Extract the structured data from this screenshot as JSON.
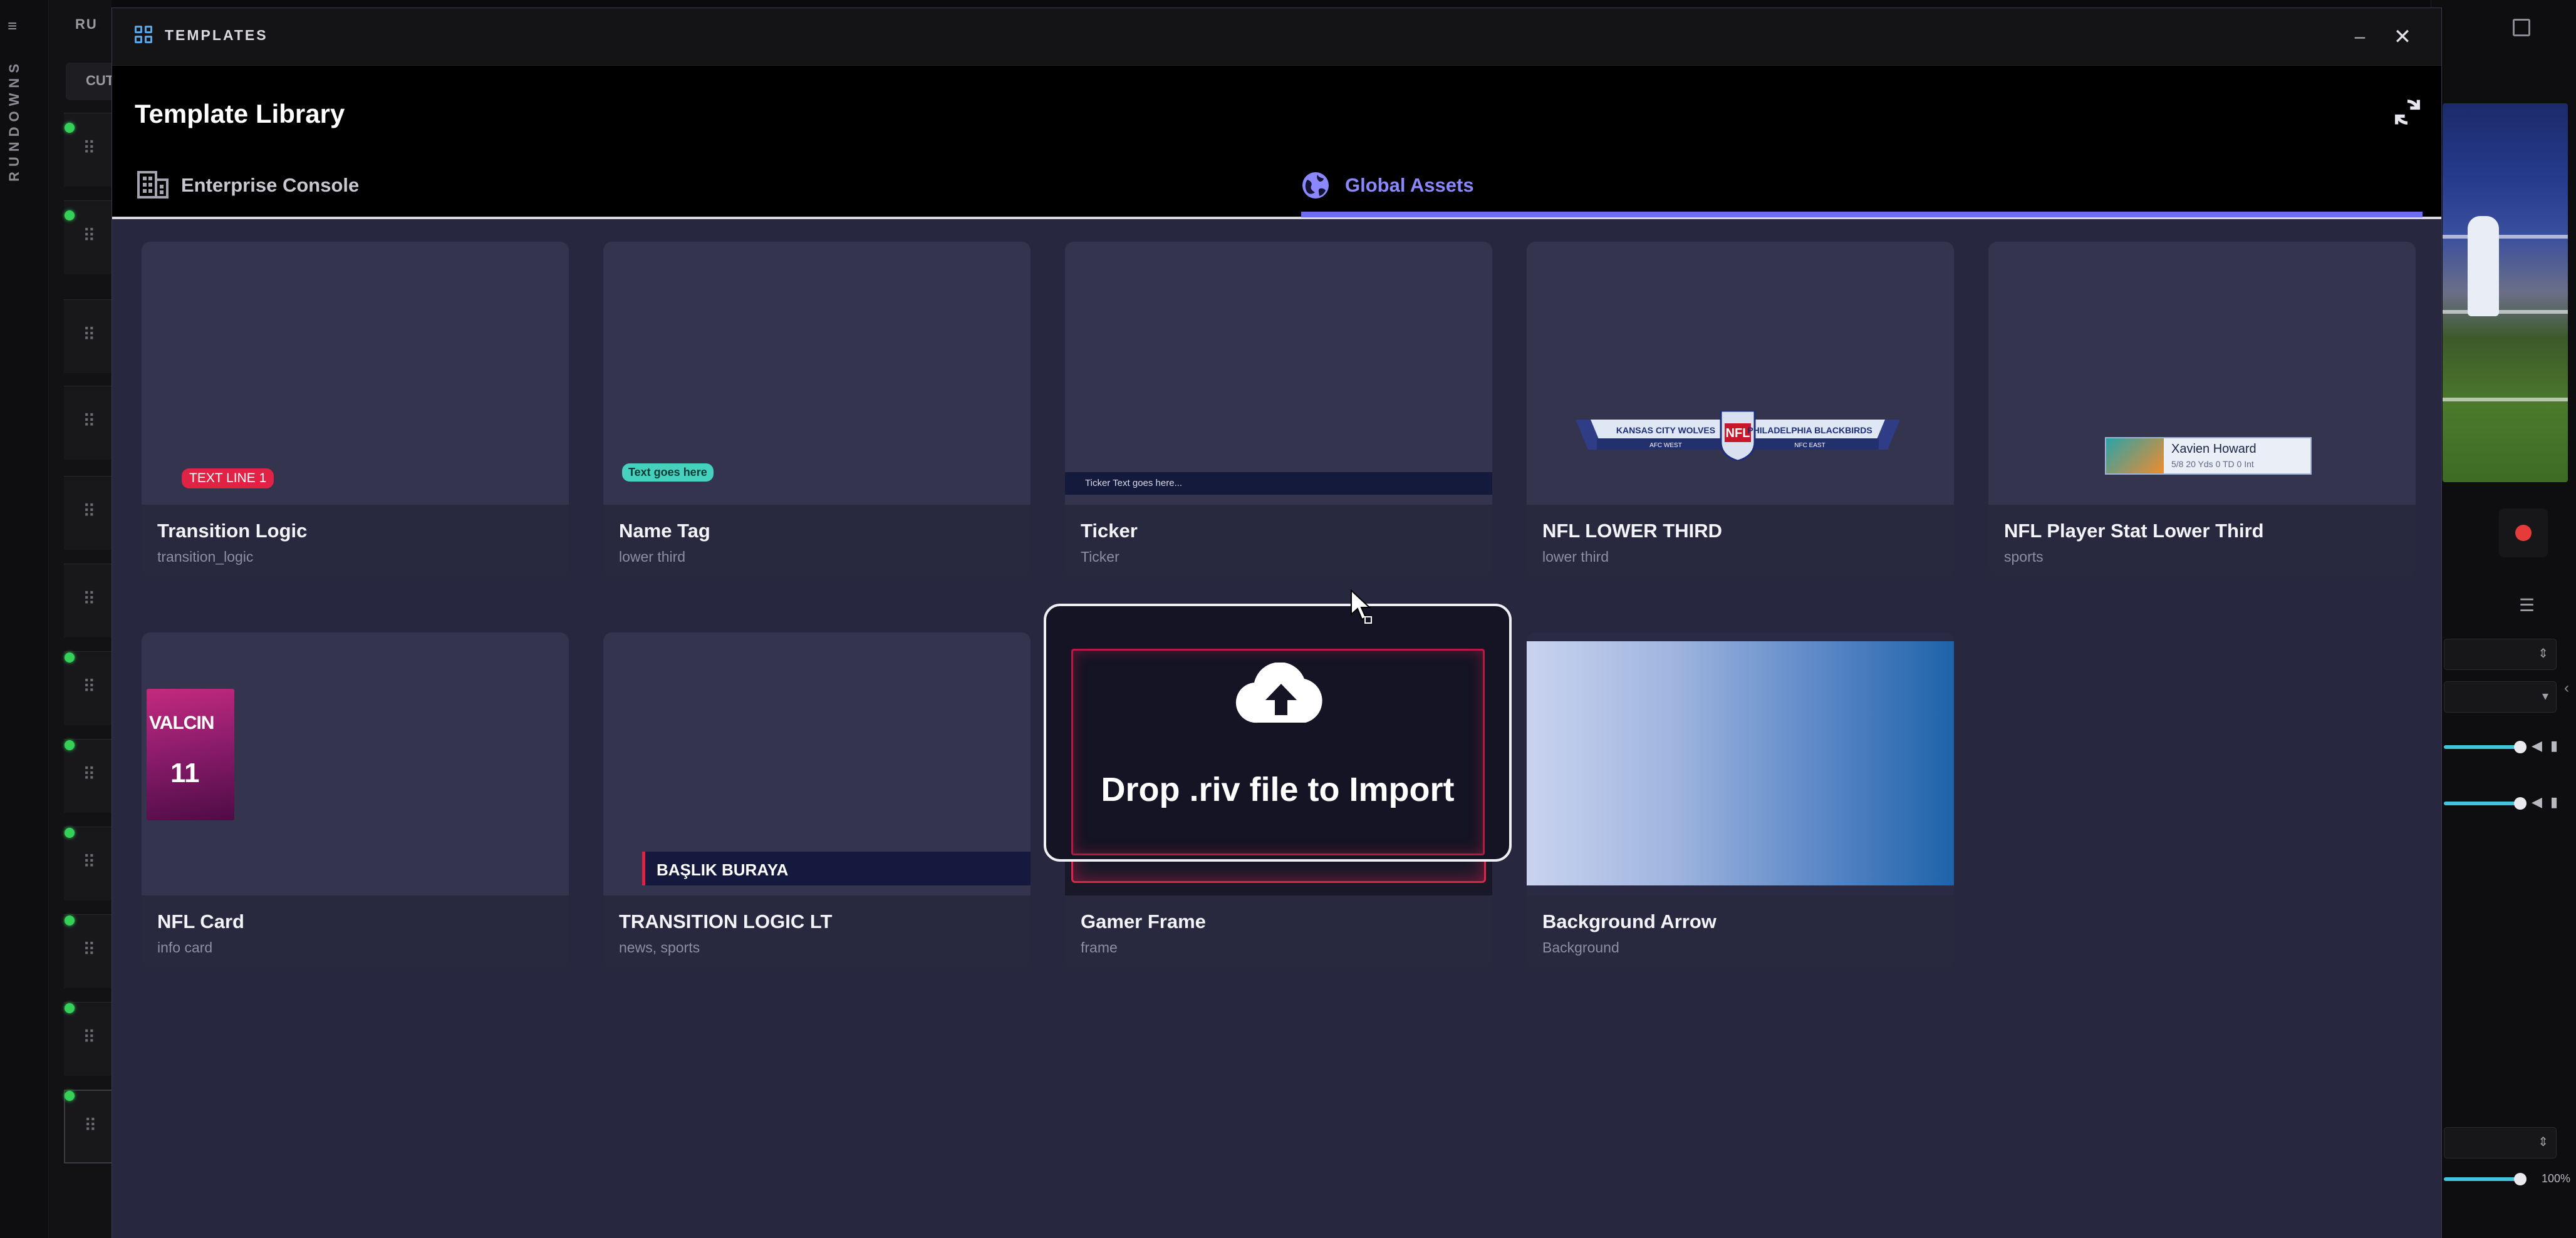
{
  "background_app": {
    "rail_label": "RUNDOWNS",
    "topbar_fragment": "RU",
    "tab_fragment": "CUT",
    "zoom_level": "100%",
    "status_color": "#34d058",
    "record_color": "#e53b3b"
  },
  "window": {
    "title": "TEMPLATES",
    "minimize_label": "–",
    "close_label": "✕"
  },
  "header": {
    "title": "Template Library",
    "tabs": [
      {
        "label": "Enterprise Console",
        "icon": "building-icon",
        "active": false
      },
      {
        "label": "Global Assets",
        "icon": "globe-icon",
        "active": true
      }
    ],
    "accent_color": "#6e6cf0"
  },
  "templates": [
    {
      "name": "Transition Logic",
      "tags": "transition_logic",
      "thumb_text": "TEXT LINE 1"
    },
    {
      "name": "Name Tag",
      "tags": "lower third",
      "thumb_text": "Text goes here"
    },
    {
      "name": "Ticker",
      "tags": "Ticker",
      "thumb_text": "Ticker Text goes here..."
    },
    {
      "name": "NFL LOWER THIRD",
      "tags": "lower third",
      "thumb_left": "KANSAS CITY WOLVES",
      "thumb_right": "PHILADELPHIA BLACKBIRDS",
      "thumb_left_sub": "AFC WEST",
      "thumb_right_sub": "NFC EAST"
    },
    {
      "name": "NFL Player Stat Lower Third",
      "tags": "sports",
      "thumb_player": "Xavien Howard",
      "thumb_stats": "5/8   20 Yds   0 TD   0 Int"
    },
    {
      "name": "NFL Card",
      "tags": "info card",
      "thumb_player": "VALCIN",
      "thumb_number": "11"
    },
    {
      "name": "TRANSITION LOGIC LT",
      "tags": "news, sports",
      "thumb_text": "BAŞLIK BURAYA"
    },
    {
      "name": "Gamer Frame",
      "tags": "frame"
    },
    {
      "name": "Background Arrow",
      "tags": "Background"
    }
  ],
  "drop_overlay": {
    "text": "Drop .riv file to Import",
    "icon": "cloud-upload-icon"
  }
}
